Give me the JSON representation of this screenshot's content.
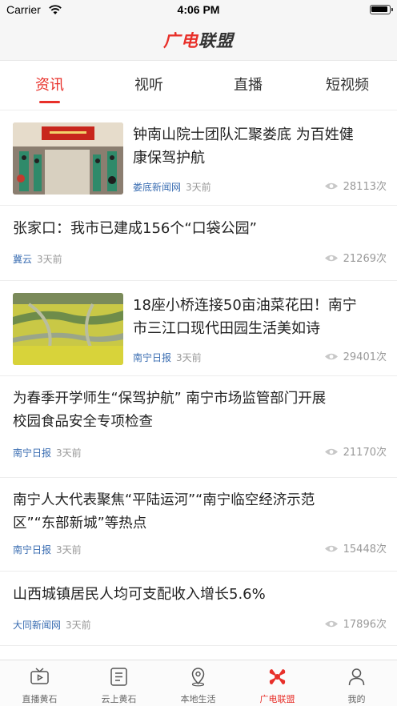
{
  "status_bar": {
    "carrier": "Carrier",
    "time": "4:06 PM"
  },
  "header": {
    "logo_part1": "广电",
    "logo_part2": "联盟"
  },
  "tabs": [
    {
      "label": "资讯",
      "active": true
    },
    {
      "label": "视听",
      "active": false
    },
    {
      "label": "直播",
      "active": false
    },
    {
      "label": "短视频",
      "active": false
    }
  ],
  "news": [
    {
      "title_line1": "钟南山院士团队汇聚娄底 为百姓健",
      "title_line2": "康保驾护航",
      "source": "娄底新闻网",
      "ago": "3天前",
      "views": "28113次",
      "has_image": true,
      "image": "conference-hall-photo"
    },
    {
      "title_line1": "张家口：我市已建成156个“口袋公园”",
      "title_line2": "",
      "source": "冀云",
      "ago": "3天前",
      "views": "21269次",
      "has_image": false
    },
    {
      "title_line1": "18座小桥连接50亩油菜花田！南宁",
      "title_line2": "市三江口现代田园生活美如诗",
      "source": "南宁日报",
      "ago": "3天前",
      "views": "29401次",
      "has_image": true,
      "image": "rapeseed-field-photo"
    },
    {
      "title_line1": "为春季开学师生“保驾护航” 南宁市场监管部门开展",
      "title_line2": "校园食品安全专项检查",
      "source": "南宁日报",
      "ago": "3天前",
      "views": "21170次",
      "has_image": false
    },
    {
      "title_line1": "南宁人大代表聚焦“平陆运河”“南宁临空经济示范",
      "title_line2": "区”“东部新城”等热点",
      "source": "南宁日报",
      "ago": "3天前",
      "views": "15448次",
      "has_image": false
    },
    {
      "title_line1": "山西城镇居民人均可支配收入增长5.6%",
      "title_line2": "",
      "source": "大同新闻网",
      "ago": "3天前",
      "views": "17896次",
      "has_image": false
    }
  ],
  "tabbar": [
    {
      "label": "直播黄石",
      "icon": "tv-icon",
      "active": false
    },
    {
      "label": "云上黄石",
      "icon": "list-icon",
      "active": false
    },
    {
      "label": "本地生活",
      "icon": "location-pin-icon",
      "active": false
    },
    {
      "label": "广电联盟",
      "icon": "alliance-logo-icon",
      "active": true
    },
    {
      "label": "我的",
      "icon": "person-icon",
      "active": false
    }
  ],
  "colors": {
    "accent": "#e8302a",
    "source": "#3a6db2",
    "muted": "#999999"
  }
}
